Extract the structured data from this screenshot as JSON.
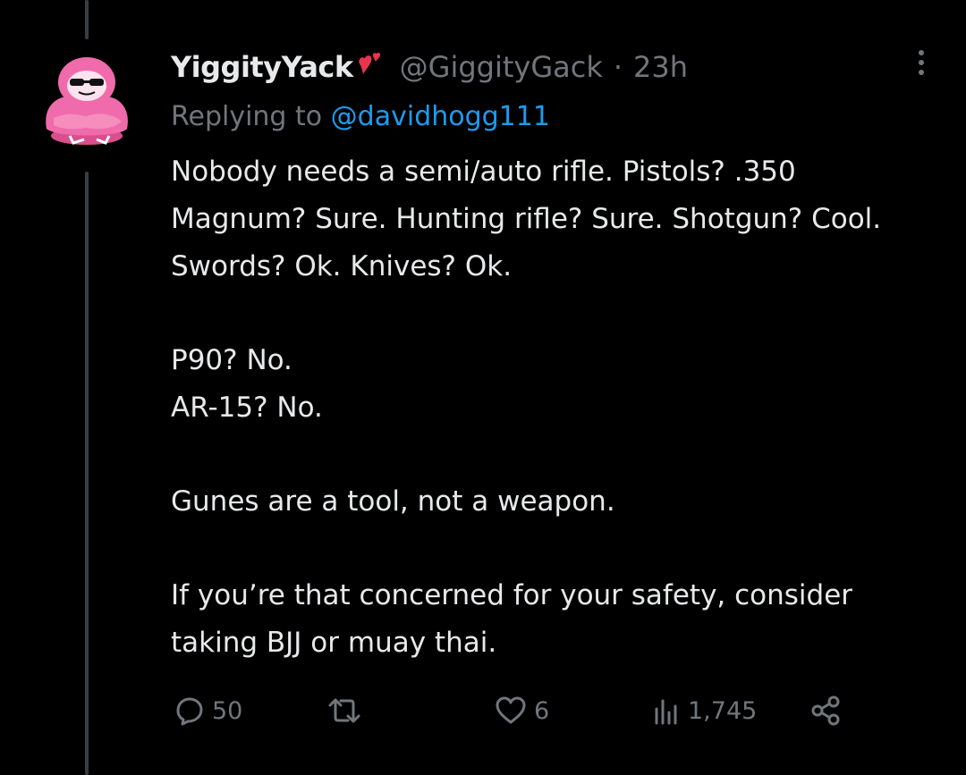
{
  "tweet": {
    "display_name": "YiggityYack",
    "name_emoji": "two-hearts-icon",
    "handle": "@GiggityGack",
    "separator": "·",
    "time": "23h",
    "reply_prefix": "Replying to ",
    "reply_target": "@davidhogg111",
    "paragraphs": [
      "Nobody needs a semi/auto rifle. Pistols? .350 Magnum? Sure. Hunting rifle? Sure. Shotgun? Cool. Swords? Ok. Knives? Ok.",
      "P90? No.\nAR-15? No.",
      "Gunes are a tool, not a weapon.",
      "If you’re that concerned for your safety, consider taking BJJ or muay thai."
    ]
  },
  "actions": {
    "reply_count": "50",
    "retweet_count": "",
    "like_count": "6",
    "views_count": "1,745"
  },
  "colors": {
    "background": "#000000",
    "text_primary": "#e7e9ea",
    "text_secondary": "#71767b",
    "accent": "#1d9bf0",
    "avatar_pink": "#f06bab",
    "heart_red": "#e8344e"
  }
}
